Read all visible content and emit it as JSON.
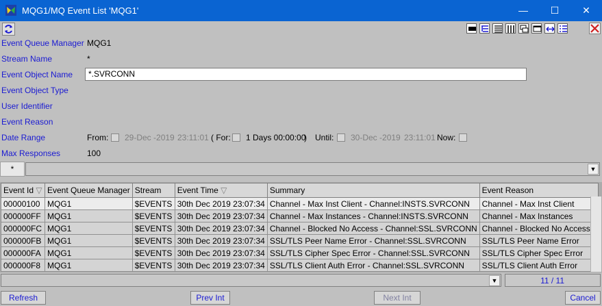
{
  "window": {
    "title": "MQG1/MQ Event List 'MQG1'",
    "minimize": "—",
    "maximize": "☐",
    "close": "✕",
    "accent": "#0a64d2"
  },
  "form": {
    "queue_manager": {
      "label": "Event Queue Manager",
      "value": "MQG1"
    },
    "stream_name": {
      "label": "Stream Name",
      "value": "*"
    },
    "object_name": {
      "label": "Event Object Name",
      "value": "*.SVRCONN"
    },
    "object_type": {
      "label": "Event Object Type"
    },
    "user_id": {
      "label": "User Identifier"
    },
    "reason": {
      "label": "Event Reason"
    },
    "date_range": {
      "label": "Date Range",
      "from_label": "From:",
      "from_date": "29-Dec -2019",
      "from_time": "23:11:01",
      "for_label": "( For:",
      "for_value": "1 Days 00:00:00",
      "for_close": ")",
      "until_label": "Until:",
      "until_date": "30-Dec -2019",
      "until_time": "23:11:01",
      "now_label": "Now:"
    },
    "max_responses": {
      "label": "Max Responses",
      "value": "100"
    }
  },
  "filter": {
    "star": "*"
  },
  "table": {
    "columns": [
      "Event Id",
      "Event Queue Manager",
      "Stream",
      "Event Time",
      "Summary",
      "Event Reason"
    ],
    "sort_marker": "▽",
    "rows": [
      [
        "00000100",
        "MQG1",
        "$EVENTS",
        "30th Dec 2019 23:07:34",
        "Channel - Max Inst Client - Channel:INSTS.SVRCONN",
        "Channel - Max Inst Client"
      ],
      [
        "000000FF",
        "MQG1",
        "$EVENTS",
        "30th Dec 2019 23:07:34",
        "Channel - Max Instances - Channel:INSTS.SVRCONN",
        "Channel - Max Instances"
      ],
      [
        "000000FC",
        "MQG1",
        "$EVENTS",
        "30th Dec 2019 23:07:34",
        "Channel - Blocked No Access - Channel:SSL.SVRCONN",
        "Channel - Blocked No Access"
      ],
      [
        "000000FB",
        "MQG1",
        "$EVENTS",
        "30th Dec 2019 23:07:34",
        "SSL/TLS Peer Name Error - Channel:SSL.SVRCONN",
        "SSL/TLS Peer Name Error"
      ],
      [
        "000000FA",
        "MQG1",
        "$EVENTS",
        "30th Dec 2019 23:07:34",
        "SSL/TLS Cipher Spec Error - Channel:SSL.SVRCONN",
        "SSL/TLS Cipher Spec Error"
      ],
      [
        "000000F8",
        "MQG1",
        "$EVENTS",
        "30th Dec 2019 23:07:34",
        "SSL/TLS Client Auth Error - Channel:SSL.SVRCONN",
        "SSL/TLS Client Auth Error"
      ]
    ]
  },
  "status": {
    "page": "11 / 11"
  },
  "buttons": {
    "refresh": "Refresh",
    "prev": "Prev Int",
    "next": "Next Int",
    "cancel": "Cancel"
  }
}
